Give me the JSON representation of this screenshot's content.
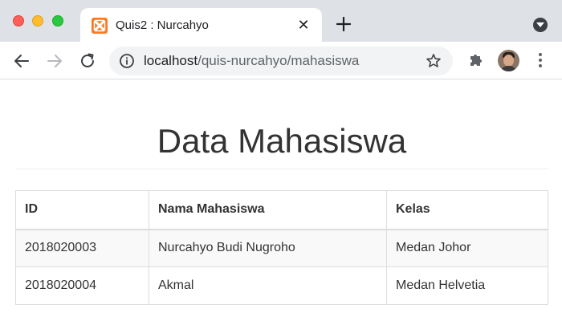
{
  "browser": {
    "tab": {
      "title": "Quis2 : Nurcahyo",
      "favicon": "xampp-icon",
      "close_symbol": "✕"
    },
    "new_tab_icon": "plus-icon",
    "address": {
      "host": "localhost",
      "path": "/quis-nurcahyo/mahasiswa"
    },
    "colors": {
      "chrome_bg": "#dee1e6",
      "omnibox_bg": "#f1f3f4",
      "favicon": "#fb7a24"
    }
  },
  "page": {
    "title": "Data Mahasiswa",
    "table": {
      "headers": [
        "ID",
        "Nama Mahasiswa",
        "Kelas"
      ],
      "rows": [
        [
          "2018020003",
          "Nurcahyo Budi Nugroho",
          "Medan Johor"
        ],
        [
          "2018020004",
          "Akmal",
          "Medan Helvetia"
        ]
      ]
    }
  }
}
